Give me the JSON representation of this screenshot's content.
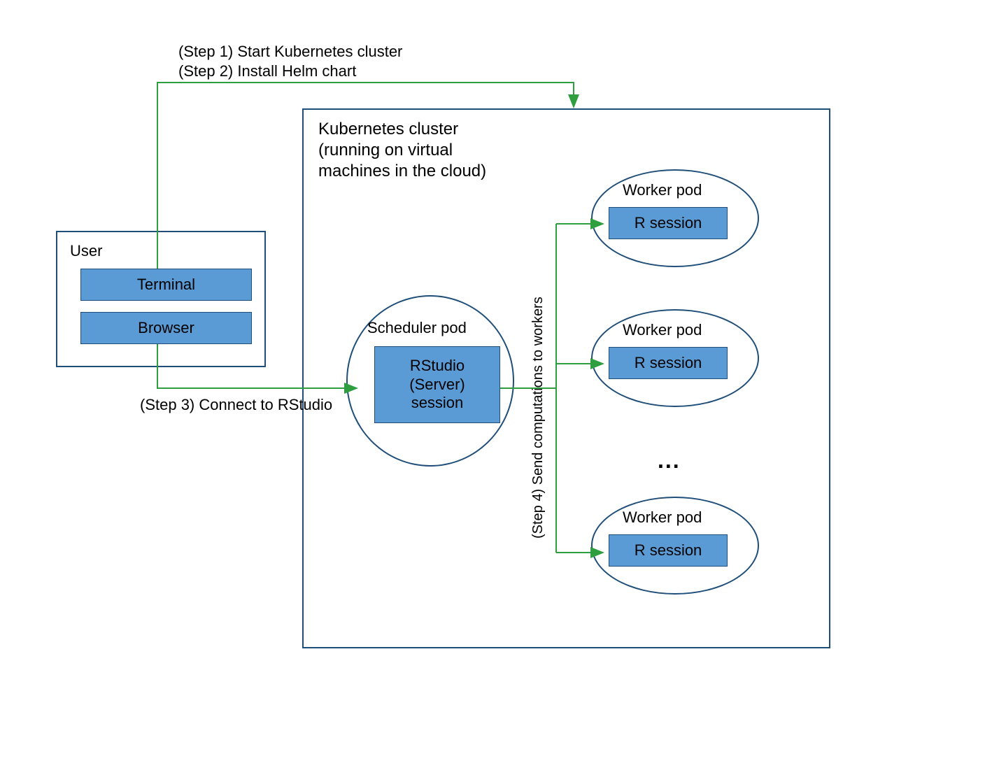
{
  "steps": {
    "s1": "(Step 1) Start Kubernetes cluster",
    "s2": "(Step 2) Install Helm chart",
    "s3": "(Step 3) Connect to RStudio",
    "s4": "(Step 4) Send computations to workers"
  },
  "user": {
    "title": "User",
    "terminal": "Terminal",
    "browser": "Browser"
  },
  "cluster": {
    "title": "Kubernetes cluster\n(running on virtual\nmachines in the cloud)"
  },
  "scheduler": {
    "title": "Scheduler pod",
    "session": "RStudio\n(Server)\nsession"
  },
  "worker": {
    "title": "Worker pod",
    "session": "R session"
  },
  "ellipsis": "...",
  "colors": {
    "node_fill": "#5b9bd5",
    "border": "#1f4e79",
    "arrow": "#2e9e3f"
  }
}
